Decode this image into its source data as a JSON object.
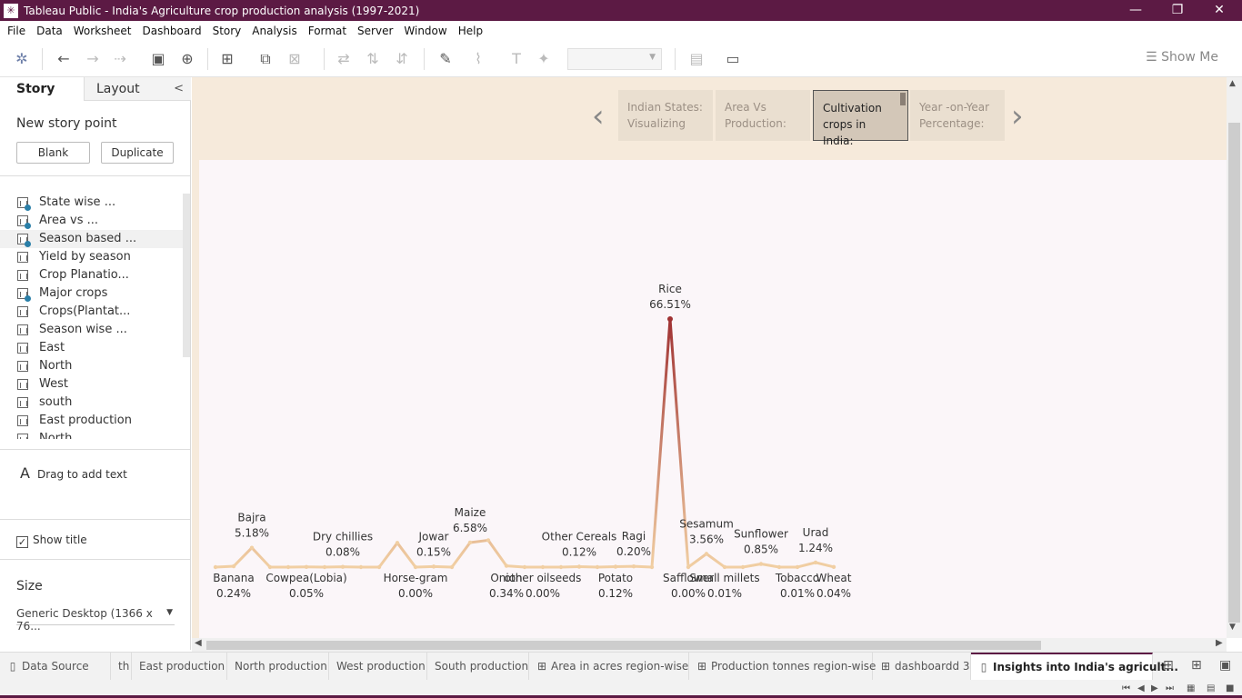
{
  "window": {
    "title": "Tableau Public - India's Agriculture crop production analysis (1997-2021)",
    "minimize": "—",
    "restore": "❐",
    "close": "✕"
  },
  "menu": [
    "File",
    "Data",
    "Worksheet",
    "Dashboard",
    "Story",
    "Analysis",
    "Format",
    "Server",
    "Window",
    "Help"
  ],
  "toolbar": {
    "show_me": "Show Me"
  },
  "left_panel": {
    "tab_story": "Story",
    "tab_layout": "Layout",
    "collapse": "<",
    "new_story_point": "New story point",
    "blank_button": "Blank",
    "duplicate_button": "Duplicate",
    "items": [
      {
        "label": "State wise ...",
        "checked": true
      },
      {
        "label": "Area vs ...",
        "checked": true
      },
      {
        "label": "Season based ...",
        "checked": true
      },
      {
        "label": "Yield by season",
        "checked": false
      },
      {
        "label": "Crop Planatio...",
        "checked": false
      },
      {
        "label": "Major crops",
        "checked": true
      },
      {
        "label": "Crops(Plantat...",
        "checked": false
      },
      {
        "label": "Season wise ...",
        "checked": false
      },
      {
        "label": "East",
        "checked": false
      },
      {
        "label": "North",
        "checked": false
      },
      {
        "label": "West",
        "checked": false
      },
      {
        "label": "south",
        "checked": false
      },
      {
        "label": "East production",
        "checked": false
      },
      {
        "label": "North",
        "checked": false
      }
    ],
    "drag_text": "Drag to add text",
    "show_title": "Show title",
    "size_label": "Size",
    "size_value": "Generic Desktop (1366 x 76..."
  },
  "story_points": [
    {
      "line1": "Indian States:",
      "line2": "Visualizing"
    },
    {
      "line1": "Area Vs",
      "line2": "Production:"
    },
    {
      "line1": "Cultivation",
      "line2": "crops in India:"
    },
    {
      "line1": "Year -on-Year",
      "line2": "Percentage:"
    }
  ],
  "chart_data": {
    "type": "line",
    "ylim": [
      0,
      70
    ],
    "points": [
      {
        "crop": "",
        "value": 0.0
      },
      {
        "crop": "Banana",
        "value": 0.24
      },
      {
        "crop": "Bajra",
        "value": 5.18
      },
      {
        "crop": "",
        "value": 0.0
      },
      {
        "crop": "",
        "value": 0.0
      },
      {
        "crop": "Cowpea(Lobia)",
        "value": 0.05
      },
      {
        "crop": "",
        "value": 0.0
      },
      {
        "crop": "Dry chillies",
        "value": 0.08
      },
      {
        "crop": "",
        "value": 0.0
      },
      {
        "crop": "",
        "value": 0.0
      },
      {
        "crop": "",
        "value": 6.5
      },
      {
        "crop": "Horse-gram",
        "value": 0.0
      },
      {
        "crop": "Jowar",
        "value": 0.15
      },
      {
        "crop": "",
        "value": 0.0
      },
      {
        "crop": "Maize",
        "value": 6.58
      },
      {
        "crop": "",
        "value": 7.2
      },
      {
        "crop": "Onion",
        "value": 0.34
      },
      {
        "crop": "",
        "value": 0.0
      },
      {
        "crop": "other oilseeds",
        "value": 0.0
      },
      {
        "crop": "",
        "value": 0.0
      },
      {
        "crop": "Other Cereals",
        "value": 0.12
      },
      {
        "crop": "",
        "value": 0.0
      },
      {
        "crop": "Potato",
        "value": 0.12
      },
      {
        "crop": "Ragi",
        "value": 0.2
      },
      {
        "crop": "",
        "value": 0.0
      },
      {
        "crop": "Rice",
        "value": 66.51
      },
      {
        "crop": "Safflower",
        "value": 0.0
      },
      {
        "crop": "Sesamum",
        "value": 3.56
      },
      {
        "crop": "Small millets",
        "value": 0.01
      },
      {
        "crop": "",
        "value": 0.0
      },
      {
        "crop": "Sunflower",
        "value": 0.85
      },
      {
        "crop": "",
        "value": 0.0
      },
      {
        "crop": "Tobacco",
        "value": 0.01
      },
      {
        "crop": "Urad",
        "value": 1.24
      },
      {
        "crop": "Wheat",
        "value": 0.04
      }
    ],
    "labels": [
      {
        "name": "Bajra",
        "pct": "5.18%",
        "pos": "above"
      },
      {
        "name": "Banana",
        "pct": "0.24%",
        "pos": "below"
      },
      {
        "name": "Dry chillies",
        "pct": "0.08%",
        "pos": "above"
      },
      {
        "name": "Cowpea(Lobia)",
        "pct": "0.05%",
        "pos": "below"
      },
      {
        "name": "Horse-gram",
        "pct": "0.00%",
        "pos": "below"
      },
      {
        "name": "Jowar",
        "pct": "0.15%",
        "pos": "above"
      },
      {
        "name": "Maize",
        "pct": "6.58%",
        "pos": "above"
      },
      {
        "name": "Onion",
        "pct": "0.34%",
        "pos": "below"
      },
      {
        "name": "other oilseeds",
        "pct": "0.00%",
        "pos": "below"
      },
      {
        "name": "Other Cereals",
        "pct": "0.12%",
        "pos": "above"
      },
      {
        "name": "Potato",
        "pct": "0.12%",
        "pos": "below"
      },
      {
        "name": "Ragi",
        "pct": "0.20%",
        "pos": "above"
      },
      {
        "name": "Rice",
        "pct": "66.51%",
        "pos": "above"
      },
      {
        "name": "Safflower",
        "pct": "0.00%",
        "pos": "below"
      },
      {
        "name": "Sesamum",
        "pct": "3.56%",
        "pos": "above"
      },
      {
        "name": "Small millets",
        "pct": "0.01%",
        "pos": "below"
      },
      {
        "name": "Sunflower",
        "pct": "0.85%",
        "pos": "above"
      },
      {
        "name": "Tobacco",
        "pct": "0.01%",
        "pos": "below"
      },
      {
        "name": "Urad",
        "pct": "1.24%",
        "pos": "above"
      },
      {
        "name": "Wheat",
        "pct": "0.04%",
        "pos": "below"
      }
    ],
    "colors": {
      "low": "#f1cfa3",
      "high": "#a03233"
    }
  },
  "bottom_tabs": [
    {
      "label": "Data Source",
      "icon": "data-source-icon",
      "glyph": "▯"
    },
    {
      "label": "th",
      "icon": "",
      "glyph": ""
    },
    {
      "label": "East production",
      "icon": "",
      "glyph": ""
    },
    {
      "label": "North production",
      "icon": "",
      "glyph": ""
    },
    {
      "label": "West production",
      "icon": "",
      "glyph": ""
    },
    {
      "label": "South production",
      "icon": "",
      "glyph": ""
    },
    {
      "label": "Area in acres region-wise",
      "icon": "dashboard-icon",
      "glyph": "⊞"
    },
    {
      "label": "Production tonnes region-wise",
      "icon": "dashboard-icon",
      "glyph": "⊞"
    },
    {
      "label": "dashboardd 3",
      "icon": "dashboard-icon",
      "glyph": "⊞"
    },
    {
      "label": "Insights into India's agricult...",
      "icon": "story-icon",
      "glyph": "▯"
    }
  ]
}
